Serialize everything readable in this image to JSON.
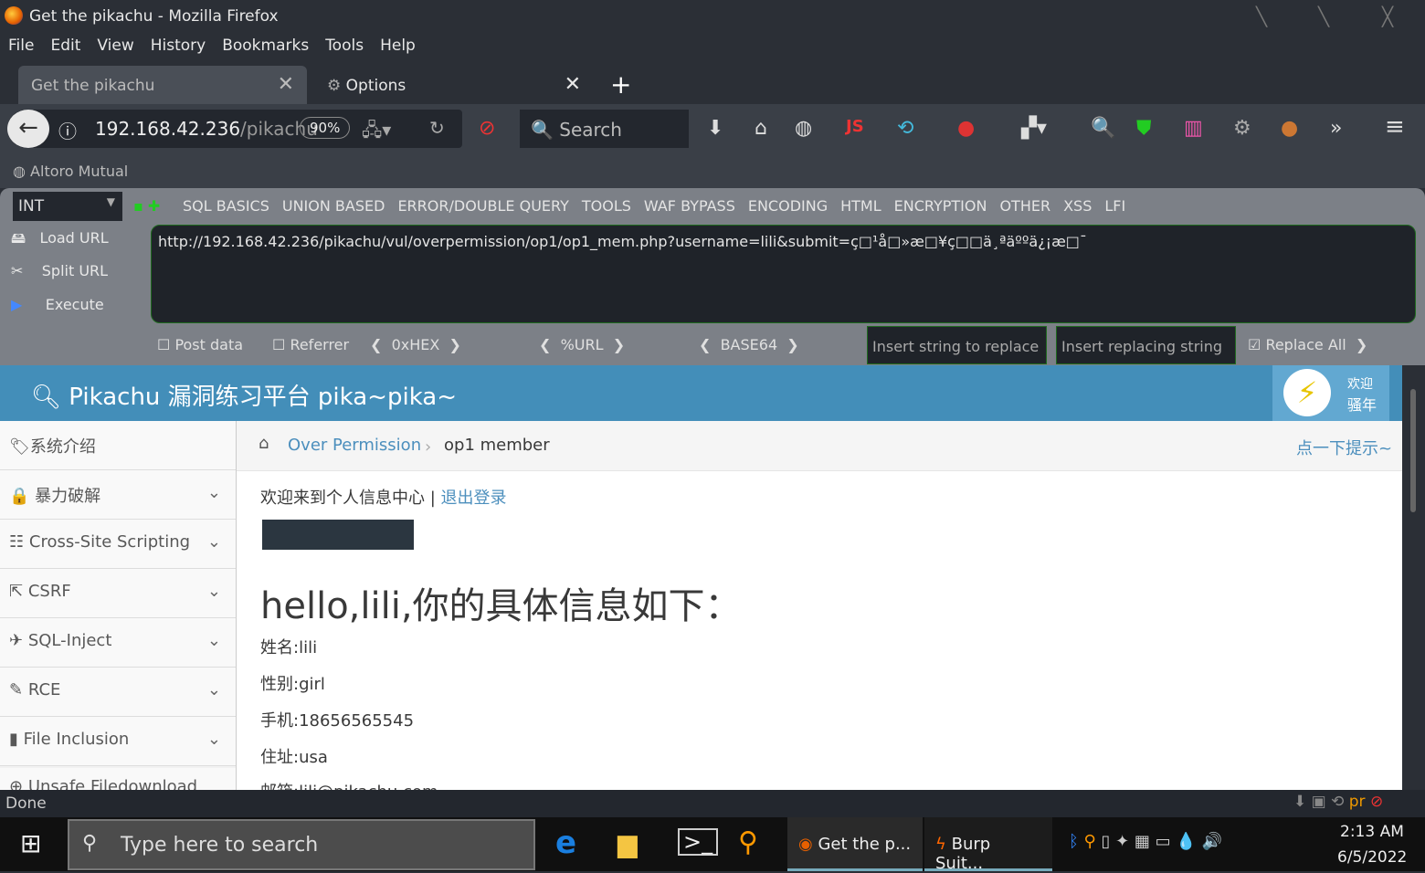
{
  "window": {
    "title": "Get the pikachu - Mozilla Firefox"
  },
  "menu": [
    "File",
    "Edit",
    "View",
    "History",
    "Bookmarks",
    "Tools",
    "Help"
  ],
  "tabs": [
    {
      "label": "Get the pikachu"
    },
    {
      "label": "Options"
    }
  ],
  "nav": {
    "url_host": "192.168.42.236",
    "url_path": "/pikachu",
    "zoom": "90%",
    "search_placeholder": "Search"
  },
  "bookmarks": [
    "Altoro Mutual"
  ],
  "hackbar": {
    "type_select": "INT",
    "menus": [
      "SQL BASICS",
      "UNION BASED",
      "ERROR/DOUBLE QUERY",
      "TOOLS",
      "WAF BYPASS",
      "ENCODING",
      "HTML",
      "ENCRYPTION",
      "OTHER",
      "XSS",
      "LFI"
    ],
    "load_url": "Load URL",
    "split_url": "Split URL",
    "execute": "Execute",
    "url_value": "http://192.168.42.236/pikachu/vul/overpermission/op1/op1_mem.php?username=lili&submit=ç□¹å□»æ□¥ç□□ä¸ªäººä¿¡æ□¯",
    "post_data": "Post data",
    "referrer": "Referrer",
    "hex": "0xHEX",
    "url_enc": "%URL",
    "base64": "BASE64",
    "replace_from_placeholder": "Insert string to replace",
    "replace_to_placeholder": "Insert replacing string",
    "replace_all": "Replace All"
  },
  "site": {
    "title": "Pikachu 漏洞练习平台 pika~pika~",
    "welcome": "欢迎",
    "user": "骚年",
    "sidebar": [
      {
        "label": "系统介绍"
      },
      {
        "label": "暴力破解"
      },
      {
        "label": "Cross-Site Scripting"
      },
      {
        "label": "CSRF"
      },
      {
        "label": "SQL-Inject"
      },
      {
        "label": "RCE"
      },
      {
        "label": "File Inclusion"
      },
      {
        "label": "Unsafe Filedownload"
      }
    ],
    "breadcrumb": {
      "parent": "Over Permission",
      "current": "op1 member",
      "hint": "点一下提示~"
    },
    "welcome_text": "欢迎来到个人信息中心",
    "separator": "|",
    "logout": "退出登录",
    "heading": "hello,lili,你的具体信息如下：",
    "info": [
      "姓名:lili",
      "性别:girl",
      "手机:18656565545",
      "住址:usa",
      "邮箱:lili@pikachu.com"
    ]
  },
  "status": "Done",
  "taskbar": {
    "search_placeholder": "Type here to search",
    "tasks": [
      "Get the p...",
      "Burp Suit..."
    ],
    "time": "2:13 AM",
    "date": "6/5/2022"
  }
}
